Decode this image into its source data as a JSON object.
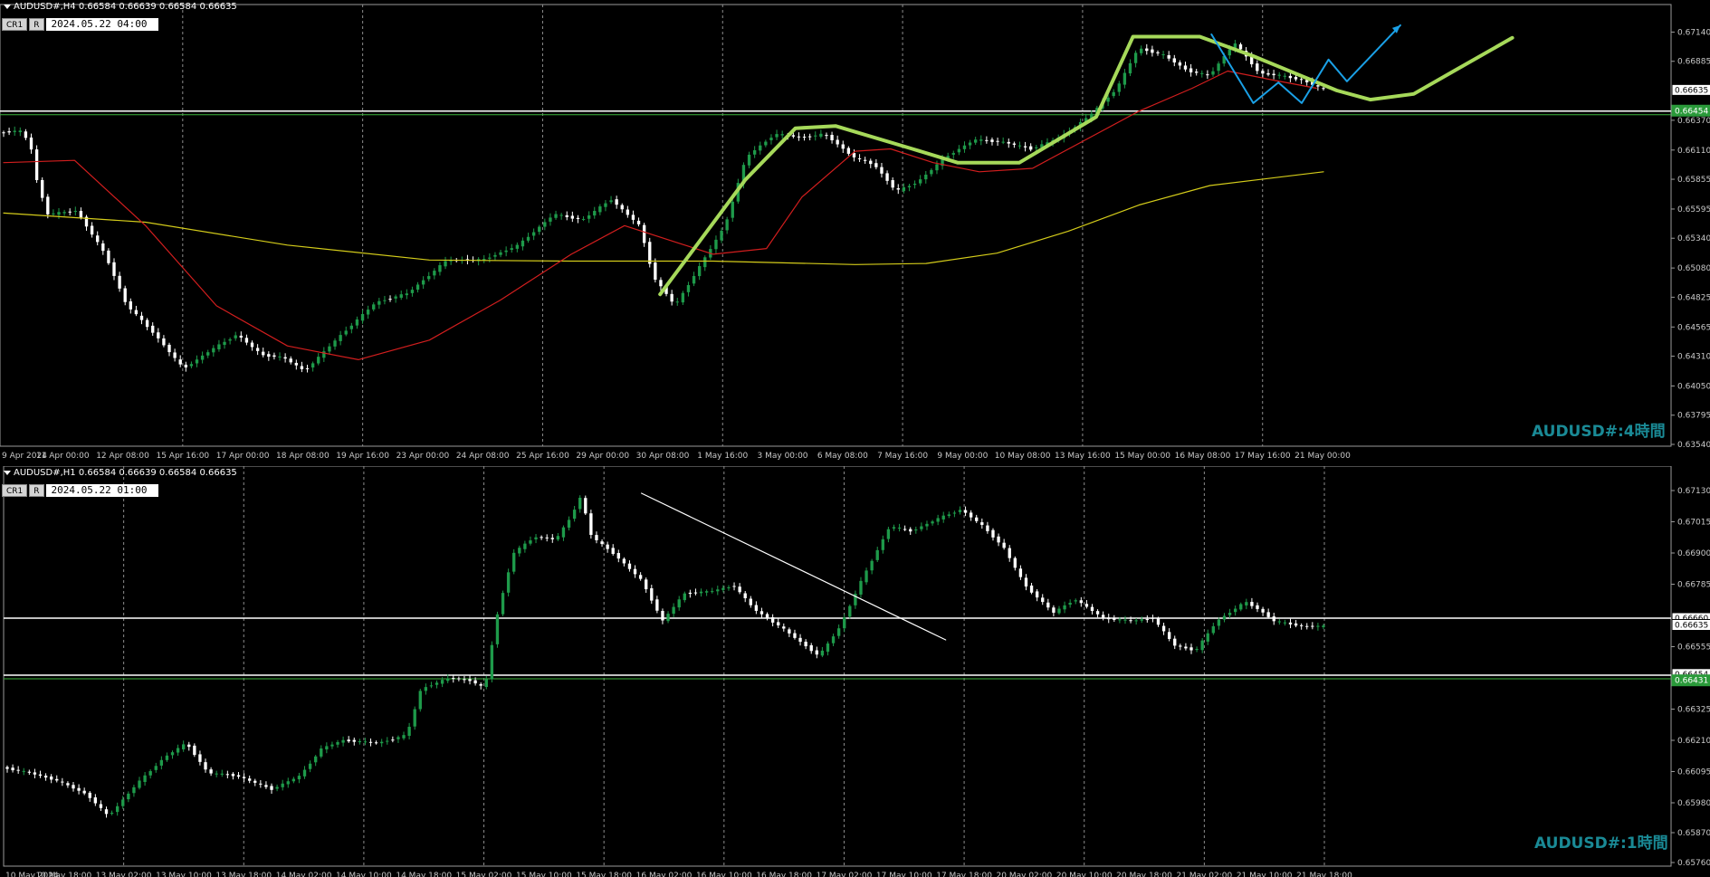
{
  "colors": {
    "bull": "#1e9a4a",
    "bear": "#ffffff",
    "ma_fast": "#d21e1e",
    "ma_slow": "#d4cc1a",
    "draw_green": "#a6d95a",
    "draw_blue": "#1aa0e6",
    "grid": "#8c8c8c",
    "axis_text": "#c8c8c8",
    "watermark": "#1a8a96",
    "green_line": "#3cb43c"
  },
  "chart_data": [
    {
      "type": "candlestick",
      "symbol_header": "AUDUSD#,H4  0.66584 0.66639 0.66584 0.66635",
      "toolbar": [
        "CR1",
        "R"
      ],
      "cursor_time": "2024.05.22 04:00",
      "watermark": "AUDUSD#:4時間",
      "ylim": [
        0.6354,
        0.6727
      ],
      "y_ticks": [
        "0.67140",
        "0.66885",
        "0.66625",
        "0.66370",
        "0.66110",
        "0.65855",
        "0.65595",
        "0.65340",
        "0.65080",
        "0.64825",
        "0.64565",
        "0.64310",
        "0.64050",
        "0.63795",
        "0.63540"
      ],
      "x_ticks": [
        "9 Apr 2024",
        "11 Apr 00:00",
        "12 Apr 08:00",
        "15 Apr 16:00",
        "17 Apr 00:00",
        "18 Apr 08:00",
        "19 Apr 16:00",
        "23 Apr 00:00",
        "24 Apr 08:00",
        "25 Apr 16:00",
        "29 Apr 00:00",
        "30 Apr 08:00",
        "1 May 16:00",
        "3 May 00:00",
        "6 May 08:00",
        "7 May 16:00",
        "9 May 00:00",
        "10 May 08:00",
        "13 May 16:00",
        "15 May 00:00",
        "16 May 08:00",
        "17 May 16:00",
        "21 May 00:00"
      ],
      "price_labels": [
        {
          "text": "0.66635",
          "price": 0.66635,
          "style": "box"
        },
        {
          "text": "0.66454",
          "price": 0.66454,
          "style": "green"
        }
      ],
      "hlines": [
        0.6645
      ],
      "candle_count": 240,
      "anchors": [
        [
          0,
          0.6626
        ],
        [
          6,
          0.6628
        ],
        [
          9,
          0.6617
        ],
        [
          11,
          0.6582
        ],
        [
          14,
          0.6555
        ],
        [
          22,
          0.6558
        ],
        [
          30,
          0.652
        ],
        [
          36,
          0.6476
        ],
        [
          44,
          0.645
        ],
        [
          52,
          0.642
        ],
        [
          60,
          0.6437
        ],
        [
          67,
          0.645
        ],
        [
          74,
          0.6432
        ],
        [
          80,
          0.643
        ],
        [
          86,
          0.6418
        ],
        [
          96,
          0.6449
        ],
        [
          106,
          0.6478
        ],
        [
          115,
          0.6486
        ],
        [
          126,
          0.6515
        ],
        [
          136,
          0.6515
        ],
        [
          146,
          0.6528
        ],
        [
          156,
          0.6555
        ],
        [
          164,
          0.655
        ],
        [
          172,
          0.6568
        ],
        [
          180,
          0.6545
        ],
        [
          184,
          0.65
        ],
        [
          190,
          0.6475
        ],
        [
          197,
          0.651
        ],
        [
          204,
          0.6545
        ],
        [
          210,
          0.6605
        ],
        [
          218,
          0.6625
        ],
        [
          226,
          0.6622
        ],
        [
          232,
          0.6625
        ],
        [
          240,
          0.6605
        ],
        [
          246,
          0.6598
        ],
        [
          252,
          0.6575
        ],
        [
          258,
          0.6583
        ],
        [
          266,
          0.6605
        ],
        [
          274,
          0.662
        ],
        [
          282,
          0.6618
        ],
        [
          290,
          0.6612
        ],
        [
          298,
          0.6622
        ],
        [
          306,
          0.664
        ],
        [
          314,
          0.6665
        ],
        [
          320,
          0.67
        ],
        [
          327,
          0.6694
        ],
        [
          334,
          0.668
        ],
        [
          340,
          0.6676
        ],
        [
          347,
          0.6705
        ],
        [
          354,
          0.6678
        ],
        [
          360,
          0.6676
        ],
        [
          366,
          0.6672
        ],
        [
          372,
          0.6664
        ]
      ],
      "ma_fast": [
        [
          0,
          0.66
        ],
        [
          20,
          0.6602
        ],
        [
          40,
          0.6545
        ],
        [
          60,
          0.6475
        ],
        [
          80,
          0.644
        ],
        [
          100,
          0.6428
        ],
        [
          120,
          0.6445
        ],
        [
          140,
          0.648
        ],
        [
          160,
          0.652
        ],
        [
          175,
          0.6545
        ],
        [
          190,
          0.653
        ],
        [
          200,
          0.652
        ],
        [
          215,
          0.6525
        ],
        [
          225,
          0.657
        ],
        [
          240,
          0.661
        ],
        [
          250,
          0.6612
        ],
        [
          262,
          0.66
        ],
        [
          275,
          0.6592
        ],
        [
          290,
          0.6595
        ],
        [
          305,
          0.662
        ],
        [
          320,
          0.6645
        ],
        [
          335,
          0.6665
        ],
        [
          345,
          0.668
        ],
        [
          358,
          0.6672
        ],
        [
          370,
          0.6665
        ]
      ],
      "ma_slow": [
        [
          0,
          0.6556
        ],
        [
          40,
          0.6548
        ],
        [
          80,
          0.6528
        ],
        [
          120,
          0.6515
        ],
        [
          160,
          0.6514
        ],
        [
          200,
          0.6514
        ],
        [
          240,
          0.6511
        ],
        [
          260,
          0.6512
        ],
        [
          280,
          0.6521
        ],
        [
          300,
          0.654
        ],
        [
          320,
          0.6563
        ],
        [
          340,
          0.658
        ],
        [
          372,
          0.6592
        ]
      ],
      "drawing_green": [
        [
          0.395,
          0.6485
        ],
        [
          0.446,
          0.6585
        ],
        [
          0.476,
          0.663
        ],
        [
          0.5,
          0.6632
        ],
        [
          0.546,
          0.6612
        ],
        [
          0.573,
          0.66
        ],
        [
          0.61,
          0.66
        ],
        [
          0.656,
          0.664
        ],
        [
          0.678,
          0.671
        ],
        [
          0.718,
          0.671
        ],
        [
          0.75,
          0.6693
        ],
        [
          0.8,
          0.6663
        ],
        [
          0.82,
          0.6655
        ],
        [
          0.846,
          0.666
        ],
        [
          0.87,
          0.668
        ],
        [
          0.905,
          0.6709
        ]
      ],
      "drawing_blue": [
        [
          0.725,
          0.6712
        ],
        [
          0.75,
          0.6652
        ],
        [
          0.765,
          0.667
        ],
        [
          0.779,
          0.6652
        ],
        [
          0.795,
          0.669
        ],
        [
          0.806,
          0.6671
        ],
        [
          0.838,
          0.672
        ]
      ]
    },
    {
      "type": "candlestick",
      "symbol_header": "AUDUSD#,H1  0.66584 0.66639 0.66584 0.66635",
      "toolbar": [
        "CR1",
        "R"
      ],
      "cursor_time": "2024.05.22 01:00",
      "watermark": "AUDUSD#:1時間",
      "ylim": [
        0.6575,
        0.6716
      ],
      "y_ticks": [
        "0.67130",
        "0.67015",
        "0.66900",
        "0.66785",
        "0.66555",
        "0.66325",
        "0.66210",
        "0.66095",
        "0.65980",
        "0.65870",
        "0.65760"
      ],
      "x_ticks": [
        "10 May 2024",
        "10 May 18:00",
        "13 May 02:00",
        "13 May 10:00",
        "13 May 18:00",
        "14 May 02:00",
        "14 May 10:00",
        "14 May 18:00",
        "15 May 02:00",
        "15 May 10:00",
        "15 May 18:00",
        "16 May 02:00",
        "16 May 10:00",
        "16 May 18:00",
        "17 May 02:00",
        "17 May 10:00",
        "17 May 18:00",
        "20 May 02:00",
        "20 May 10:00",
        "20 May 18:00",
        "21 May 02:00",
        "21 May 10:00",
        "21 May 18:00"
      ],
      "price_labels": [
        {
          "text": "0.66660",
          "price": 0.6666,
          "style": "box"
        },
        {
          "text": "0.66635",
          "price": 0.66635,
          "style": "box"
        },
        {
          "text": "0.66454",
          "price": 0.66454,
          "style": "box"
        },
        {
          "text": "0.66431",
          "price": 0.66431,
          "style": "green"
        }
      ],
      "hlines": [
        0.6666,
        0.6645
      ],
      "candle_count": 240,
      "anchors": [
        [
          0,
          0.6611
        ],
        [
          8,
          0.6609
        ],
        [
          16,
          0.6606
        ],
        [
          24,
          0.6601
        ],
        [
          30,
          0.6593
        ],
        [
          38,
          0.6605
        ],
        [
          46,
          0.6615
        ],
        [
          52,
          0.662
        ],
        [
          58,
          0.6609
        ],
        [
          66,
          0.6608
        ],
        [
          76,
          0.6603
        ],
        [
          84,
          0.6608
        ],
        [
          90,
          0.6618
        ],
        [
          96,
          0.6621
        ],
        [
          106,
          0.662
        ],
        [
          114,
          0.6623
        ],
        [
          118,
          0.664
        ],
        [
          126,
          0.6644
        ],
        [
          132,
          0.6643
        ],
        [
          136,
          0.664
        ],
        [
          139,
          0.6665
        ],
        [
          144,
          0.669
        ],
        [
          150,
          0.6696
        ],
        [
          156,
          0.6695
        ],
        [
          160,
          0.6703
        ],
        [
          163,
          0.6711
        ],
        [
          166,
          0.6696
        ],
        [
          172,
          0.669
        ],
        [
          180,
          0.668
        ],
        [
          186,
          0.6665
        ],
        [
          192,
          0.6675
        ],
        [
          200,
          0.6676
        ],
        [
          206,
          0.6678
        ],
        [
          212,
          0.6669
        ],
        [
          220,
          0.6662
        ],
        [
          226,
          0.6656
        ],
        [
          230,
          0.6652
        ],
        [
          236,
          0.6663
        ],
        [
          242,
          0.668
        ],
        [
          250,
          0.67
        ],
        [
          256,
          0.6698
        ],
        [
          264,
          0.6703
        ],
        [
          270,
          0.6706
        ],
        [
          276,
          0.67
        ],
        [
          282,
          0.6692
        ],
        [
          288,
          0.6678
        ],
        [
          296,
          0.6668
        ],
        [
          302,
          0.6673
        ],
        [
          310,
          0.6666
        ],
        [
          318,
          0.6665
        ],
        [
          324,
          0.6666
        ],
        [
          330,
          0.6656
        ],
        [
          336,
          0.6654
        ],
        [
          342,
          0.6665
        ],
        [
          350,
          0.6672
        ],
        [
          354,
          0.6669
        ],
        [
          358,
          0.6665
        ],
        [
          366,
          0.6663
        ],
        [
          372,
          0.6663
        ]
      ],
      "drawing_white": [
        [
          0.3825,
          0.6712
        ],
        [
          0.565,
          0.6658
        ]
      ]
    }
  ]
}
